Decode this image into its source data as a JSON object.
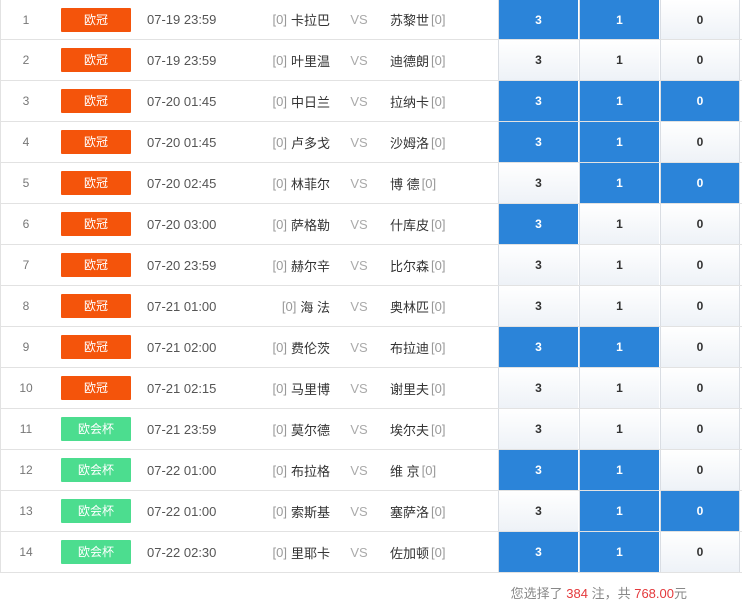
{
  "matches": [
    {
      "no": "1",
      "league": "欧冠",
      "type": "euro",
      "time": "07-19 23:59",
      "home_rank": "[0]",
      "home": "卡拉巴",
      "vs": "VS",
      "away": "苏黎世",
      "away_rank": "[0]",
      "o3": "3",
      "o1": "1",
      "o0": "0",
      "sel": [
        true,
        true,
        false
      ]
    },
    {
      "no": "2",
      "league": "欧冠",
      "type": "euro",
      "time": "07-19 23:59",
      "home_rank": "[0]",
      "home": "叶里温",
      "vs": "VS",
      "away": "迪德朗",
      "away_rank": "[0]",
      "o3": "3",
      "o1": "1",
      "o0": "0",
      "sel": [
        false,
        false,
        false
      ]
    },
    {
      "no": "3",
      "league": "欧冠",
      "type": "euro",
      "time": "07-20 01:45",
      "home_rank": "[0]",
      "home": "中日兰",
      "vs": "VS",
      "away": "拉纳卡",
      "away_rank": "[0]",
      "o3": "3",
      "o1": "1",
      "o0": "0",
      "sel": [
        true,
        true,
        true
      ]
    },
    {
      "no": "4",
      "league": "欧冠",
      "type": "euro",
      "time": "07-20 01:45",
      "home_rank": "[0]",
      "home": "卢多戈",
      "vs": "VS",
      "away": "沙姆洛",
      "away_rank": "[0]",
      "o3": "3",
      "o1": "1",
      "o0": "0",
      "sel": [
        true,
        true,
        false
      ]
    },
    {
      "no": "5",
      "league": "欧冠",
      "type": "euro",
      "time": "07-20 02:45",
      "home_rank": "[0]",
      "home": "林菲尔",
      "vs": "VS",
      "away": "博 德",
      "away_rank": "[0]",
      "o3": "3",
      "o1": "1",
      "o0": "0",
      "sel": [
        false,
        true,
        true
      ]
    },
    {
      "no": "6",
      "league": "欧冠",
      "type": "euro",
      "time": "07-20 03:00",
      "home_rank": "[0]",
      "home": "萨格勒",
      "vs": "VS",
      "away": "什库皮",
      "away_rank": "[0]",
      "o3": "3",
      "o1": "1",
      "o0": "0",
      "sel": [
        true,
        false,
        false
      ]
    },
    {
      "no": "7",
      "league": "欧冠",
      "type": "euro",
      "time": "07-20 23:59",
      "home_rank": "[0]",
      "home": "赫尔辛",
      "vs": "VS",
      "away": "比尔森",
      "away_rank": "[0]",
      "o3": "3",
      "o1": "1",
      "o0": "0",
      "sel": [
        false,
        false,
        false
      ]
    },
    {
      "no": "8",
      "league": "欧冠",
      "type": "euro",
      "time": "07-21 01:00",
      "home_rank": "[0]",
      "home": "海 法",
      "vs": "VS",
      "away": "奥林匹",
      "away_rank": "[0]",
      "o3": "3",
      "o1": "1",
      "o0": "0",
      "sel": [
        false,
        false,
        false
      ]
    },
    {
      "no": "9",
      "league": "欧冠",
      "type": "euro",
      "time": "07-21 02:00",
      "home_rank": "[0]",
      "home": "费伦茨",
      "vs": "VS",
      "away": "布拉迪",
      "away_rank": "[0]",
      "o3": "3",
      "o1": "1",
      "o0": "0",
      "sel": [
        true,
        true,
        false
      ]
    },
    {
      "no": "10",
      "league": "欧冠",
      "type": "euro",
      "time": "07-21 02:15",
      "home_rank": "[0]",
      "home": "马里博",
      "vs": "VS",
      "away": "谢里夫",
      "away_rank": "[0]",
      "o3": "3",
      "o1": "1",
      "o0": "0",
      "sel": [
        false,
        false,
        false
      ]
    },
    {
      "no": "11",
      "league": "欧会杯",
      "type": "ecl",
      "time": "07-21 23:59",
      "home_rank": "[0]",
      "home": "莫尔德",
      "vs": "VS",
      "away": "埃尔夫",
      "away_rank": "[0]",
      "o3": "3",
      "o1": "1",
      "o0": "0",
      "sel": [
        false,
        false,
        false
      ]
    },
    {
      "no": "12",
      "league": "欧会杯",
      "type": "ecl",
      "time": "07-22 01:00",
      "home_rank": "[0]",
      "home": "布拉格",
      "vs": "VS",
      "away": "维 京",
      "away_rank": "[0]",
      "o3": "3",
      "o1": "1",
      "o0": "0",
      "sel": [
        true,
        true,
        false
      ]
    },
    {
      "no": "13",
      "league": "欧会杯",
      "type": "ecl",
      "time": "07-22 01:00",
      "home_rank": "[0]",
      "home": "索斯基",
      "vs": "VS",
      "away": "塞萨洛",
      "away_rank": "[0]",
      "o3": "3",
      "o1": "1",
      "o0": "0",
      "sel": [
        false,
        true,
        true
      ]
    },
    {
      "no": "14",
      "league": "欧会杯",
      "type": "ecl",
      "time": "07-22 02:30",
      "home_rank": "[0]",
      "home": "里耶卡",
      "vs": "VS",
      "away": "佐加顿",
      "away_rank": "[0]",
      "o3": "3",
      "o1": "1",
      "o0": "0",
      "sel": [
        true,
        true,
        false
      ]
    }
  ],
  "summary": {
    "prefix": "您选择了 ",
    "bets": "384",
    "middle": " 注，共 ",
    "amount": "768.00",
    "suffix": "元"
  },
  "colors": {
    "selected": "#2b84d9",
    "euro_badge": "#f4540b",
    "ecl_badge": "#4cdd8f",
    "highlight": "#e4393c"
  }
}
